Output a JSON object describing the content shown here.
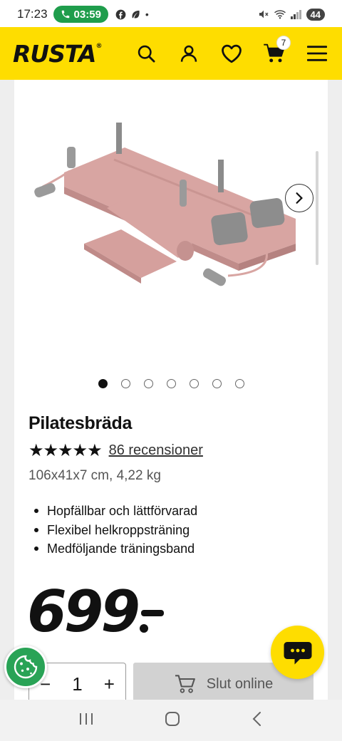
{
  "status_bar": {
    "time": "17:23",
    "call_timer": "03:59",
    "battery": "44"
  },
  "header": {
    "logo": "RUSTA",
    "cart_count": "7",
    "brand_color": "#fedd00"
  },
  "product": {
    "title": "Pilatesbräda",
    "stars": "★★★★★",
    "rating": 5,
    "reviews": "86 recensioner",
    "dimensions": "106x41x7 cm, 4,22 kg",
    "bullets": [
      "Hopfällbar och lättförvarad",
      "Flexibel helkroppsträning",
      "Medföljande träningsband"
    ],
    "price": "699",
    "image_count": 7,
    "active_image": 1
  },
  "purchase": {
    "quantity": "1",
    "minus": "−",
    "plus": "+",
    "button_label": "Slut online"
  },
  "icons": {
    "search": "search-icon",
    "account": "user-icon",
    "wishlist": "heart-icon",
    "cart": "cart-icon",
    "menu": "menu-icon",
    "cookie": "cookie-icon",
    "chat": "chat-icon"
  }
}
